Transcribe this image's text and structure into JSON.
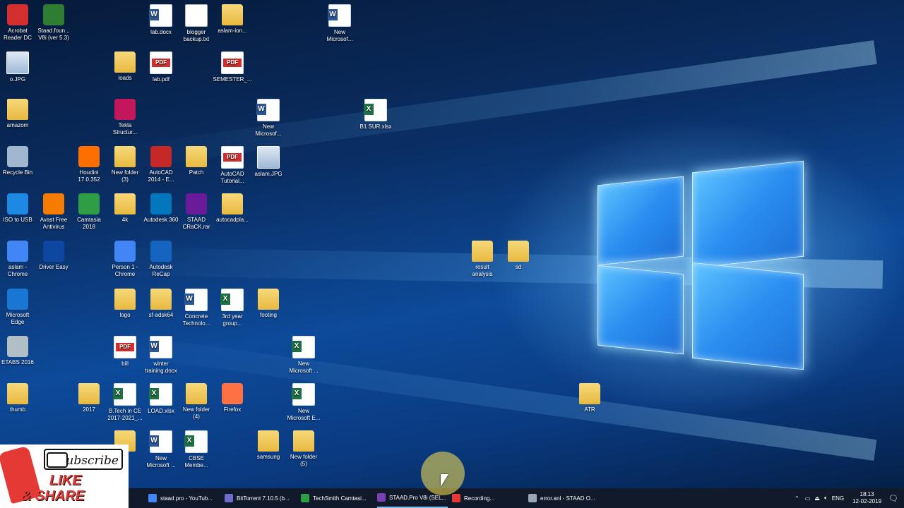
{
  "colors": {
    "taskbar": "#101a2a",
    "accent": "#76b9ed",
    "wallpaper": "#0d4a9a"
  },
  "desktop_icons": [
    {
      "label": "Acrobat\nReader DC",
      "icon": "acrobat-icon"
    },
    {
      "label": "Staad.foun...\nV8i (ver 5.3)",
      "icon": "staad-foundation-icon"
    },
    {
      "label": "lab.docx",
      "icon": "word-file-icon"
    },
    {
      "label": "blogger\nbackup.txt",
      "icon": "text-file-icon"
    },
    {
      "label": "aslam-ion...",
      "icon": "folder-icon"
    },
    {
      "label": "New\nMicrosof...",
      "icon": "word-file-icon"
    },
    {
      "label": "o.JPG",
      "icon": "image-file-icon"
    },
    {
      "label": "loads",
      "icon": "folder-icon"
    },
    {
      "label": "lab.pdf",
      "icon": "pdf-file-icon"
    },
    {
      "label": "SEMESTER_...",
      "icon": "pdf-file-icon"
    },
    {
      "label": "amazom",
      "icon": "folder-icon"
    },
    {
      "label": "Tekla\nStructur...",
      "icon": "tekla-icon"
    },
    {
      "label": "New\nMicrosof...",
      "icon": "word-file-icon"
    },
    {
      "label": "B1 SUR.xlsx",
      "icon": "excel-file-icon"
    },
    {
      "label": "Recycle Bin",
      "icon": "recycle-bin-icon"
    },
    {
      "label": "Houdini\n17.0.352",
      "icon": "houdini-icon"
    },
    {
      "label": "New folder\n(3)",
      "icon": "folder-icon"
    },
    {
      "label": "AutoCAD\n2014 - E...",
      "icon": "autocad-icon"
    },
    {
      "label": "Patch",
      "icon": "folder-icon"
    },
    {
      "label": "AutoCAD\nTutorial...",
      "icon": "pdf-file-icon"
    },
    {
      "label": "aslam.JPG",
      "icon": "image-file-icon"
    },
    {
      "label": "ISO to USB",
      "icon": "iso-to-usb-icon"
    },
    {
      "label": "Avast Free\nAntivirus",
      "icon": "avast-icon"
    },
    {
      "label": "Camtasia\n2018",
      "icon": "camtasia-icon"
    },
    {
      "label": "4k",
      "icon": "folder-icon"
    },
    {
      "label": "Autodesk 360",
      "icon": "autodesk-360-icon"
    },
    {
      "label": "STAAD\nCRaCK.rar",
      "icon": "winrar-icon"
    },
    {
      "label": "autocadpla...",
      "icon": "folder-icon"
    },
    {
      "label": "aslam -\nChrome",
      "icon": "chrome-icon"
    },
    {
      "label": "Driver Easy",
      "icon": "driver-easy-icon"
    },
    {
      "label": "Person 1 -\nChrome",
      "icon": "chrome-icon"
    },
    {
      "label": "Autodesk\nReCap",
      "icon": "recap-icon"
    },
    {
      "label": "result\nanalysis",
      "icon": "folder-icon"
    },
    {
      "label": "sd",
      "icon": "folder-icon"
    },
    {
      "label": "Microsoft\nEdge",
      "icon": "edge-icon"
    },
    {
      "label": "logo",
      "icon": "folder-icon"
    },
    {
      "label": "sf-adsk64",
      "icon": "folder-icon"
    },
    {
      "label": "Concrete\nTechnolo...",
      "icon": "word-file-icon"
    },
    {
      "label": "3rd year\ngroup...",
      "icon": "excel-file-icon"
    },
    {
      "label": "footing",
      "icon": "folder-icon"
    },
    {
      "label": "ETABS 2016",
      "icon": "etabs-icon"
    },
    {
      "label": "bill",
      "icon": "pdf-file-icon"
    },
    {
      "label": "winter\ntraining.docx",
      "icon": "word-file-icon"
    },
    {
      "label": "New\nMicrosoft ...",
      "icon": "publisher-file-icon"
    },
    {
      "label": "thumb",
      "icon": "folder-icon"
    },
    {
      "label": "2017",
      "icon": "folder-icon"
    },
    {
      "label": "B.Tech in CE\n2017-2021_...",
      "icon": "excel-file-icon"
    },
    {
      "label": "LOAD.xlsx",
      "icon": "excel-file-icon"
    },
    {
      "label": "New folder\n(4)",
      "icon": "folder-icon"
    },
    {
      "label": "Firefox",
      "icon": "firefox-icon"
    },
    {
      "label": "New\nMicrosoft E...",
      "icon": "excel-file-icon"
    },
    {
      "label": "ATR",
      "icon": "folder-icon"
    },
    {
      "label": "d",
      "icon": "folder-icon"
    },
    {
      "label": "New\nMicrosoft ...",
      "icon": "word-file-icon"
    },
    {
      "label": "CBSE\nMembe...",
      "icon": "excel-file-icon"
    },
    {
      "label": "samsung",
      "icon": "folder-icon"
    },
    {
      "label": "New folder\n(5)",
      "icon": "folder-icon"
    }
  ],
  "taskbar": {
    "items": [
      {
        "label": "staad pro - YouTub...",
        "icon": "chrome-icon",
        "color": "#4285f4"
      },
      {
        "label": "BitTorrent 7.10.5  (b...",
        "icon": "bittorrent-icon",
        "color": "#6c6cc9"
      },
      {
        "label": "TechSmith Camtasi...",
        "icon": "camtasia-icon",
        "color": "#2e9d44"
      },
      {
        "label": "STAAD.Pro V8i (SEL...",
        "icon": "staad-icon",
        "color": "#7a3fb0"
      },
      {
        "label": "Recording...",
        "icon": "recording-icon",
        "color": "#e53935"
      },
      {
        "label": "error.anl - STAAD O...",
        "icon": "notepad-icon",
        "color": "#9aa7b8"
      }
    ],
    "tray": {
      "lang": "ENG",
      "time": "18:13",
      "date": "12-02-2019"
    }
  },
  "promo": {
    "subscribe": "Subscribe",
    "like": "LIKE",
    "share": "& SHARE"
  }
}
